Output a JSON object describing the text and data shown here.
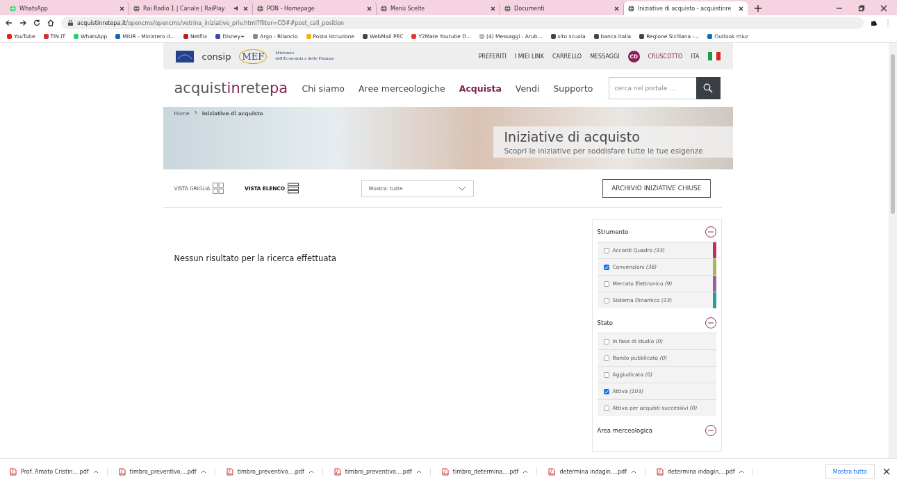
{
  "browser": {
    "tabs": [
      {
        "title": "WhatsApp",
        "selected": false,
        "audio": false
      },
      {
        "title": "Rai Radio 1 | Canale | RaiPlay",
        "selected": false,
        "audio": true
      },
      {
        "title": "PON - Homepage",
        "selected": false,
        "audio": false
      },
      {
        "title": "Menù Scelte",
        "selected": false,
        "audio": false
      },
      {
        "title": "Documenti",
        "selected": false,
        "audio": false
      },
      {
        "title": "Iniziative di acquisto - acquistinre",
        "selected": true,
        "audio": false
      }
    ],
    "address": {
      "host": "acquistinretepa.it",
      "path": "/opencms/opencms/vetrina_iniziative_priv.html?filter=CO##post_call_position"
    },
    "bookmarks": [
      "YouTube",
      "TIN.IT",
      "WhatsApp",
      "MIUR - Ministero d...",
      "Netflix",
      "Disney+",
      "Argo - Bilancio",
      "Posta istruzione",
      "WebMail PEC",
      "Y2Mate Youtube D...",
      "(4) Messaggi - Arub...",
      "sito scuola",
      "banca italia",
      "Regione Siciliana -...",
      "Outlook miur"
    ]
  },
  "site": {
    "topbar": {
      "logo_consip": "consip",
      "logo_mef": "MEF",
      "ministry": "Ministero\ndell'Economia e delle Finanze",
      "links": [
        "PREFERITI",
        "I MIEI LINK",
        "CARRELLO",
        "MESSAGGI"
      ],
      "avatar": "CD",
      "dashboard": "CRUSCOTTO",
      "language": "ITA"
    },
    "logo": {
      "part1": "acquist",
      "part2": "in",
      "part3": "rete",
      "part4": "pa"
    },
    "nav": [
      {
        "label": "Chi siamo",
        "selected": false
      },
      {
        "label": "Aree merceologiche",
        "selected": false
      },
      {
        "label": "Acquista",
        "selected": true
      },
      {
        "label": "Vendi",
        "selected": false
      },
      {
        "label": "Supporto",
        "selected": false
      }
    ],
    "search": {
      "placeholder": "cerca nel portale ..."
    },
    "breadcrumb": [
      "Home",
      "Iniziative di acquisto"
    ],
    "hero": {
      "title": "Iniziative di acquisto",
      "subtitle": "Scopri le iniziative per soddisfare tutte le tue esigenze"
    },
    "views": [
      {
        "label": "VISTA GRIGLIA",
        "selected": false,
        "kind": "grid"
      },
      {
        "label": "VISTA ELENCO",
        "selected": true,
        "kind": "list"
      }
    ],
    "filter_select": {
      "value": "Mostra: tutte"
    },
    "archive_button": "ARCHIVIO INIZIATIVE CHIUSE",
    "message": "Nessun risultato per la ricerca effettuata",
    "filters": [
      {
        "title": "Strumento",
        "expanded": true,
        "items": [
          {
            "label": "Accordi Quadro",
            "count": "(33)",
            "checked": false,
            "color": "#c22e63"
          },
          {
            "label": "Convenzioni",
            "count": "(38)",
            "checked": true,
            "color": "#a9b653"
          },
          {
            "label": "Mercato Elettronico",
            "count": "(9)",
            "checked": false,
            "color": "#9a5fa3"
          },
          {
            "label": "Sistema Dinamico",
            "count": "(23)",
            "checked": false,
            "color": "#1fa39b"
          }
        ]
      },
      {
        "title": "Stato",
        "expanded": true,
        "items": [
          {
            "label": "In fase di studio",
            "count": "(0)",
            "checked": false
          },
          {
            "label": "Bando pubblicato",
            "count": "(0)",
            "checked": false
          },
          {
            "label": "Aggiudicata",
            "count": "(0)",
            "checked": false
          },
          {
            "label": "Attiva",
            "count": "(103)",
            "checked": true
          },
          {
            "label": "Attiva per acquisti successivi",
            "count": "(0)",
            "checked": false
          }
        ]
      },
      {
        "title": "Area merceologica",
        "expanded": true
      }
    ]
  },
  "downloads": {
    "files": [
      "Prof. Amato Cristin....pdf",
      "timbro_preventivo....pdf",
      "timbro_preventivo....pdf",
      "timbro_preventivo....pdf",
      "timbro_determina....pdf",
      "determina indagin....pdf",
      "determina indagin....pdf"
    ],
    "show_all": "Mostra tutto"
  }
}
